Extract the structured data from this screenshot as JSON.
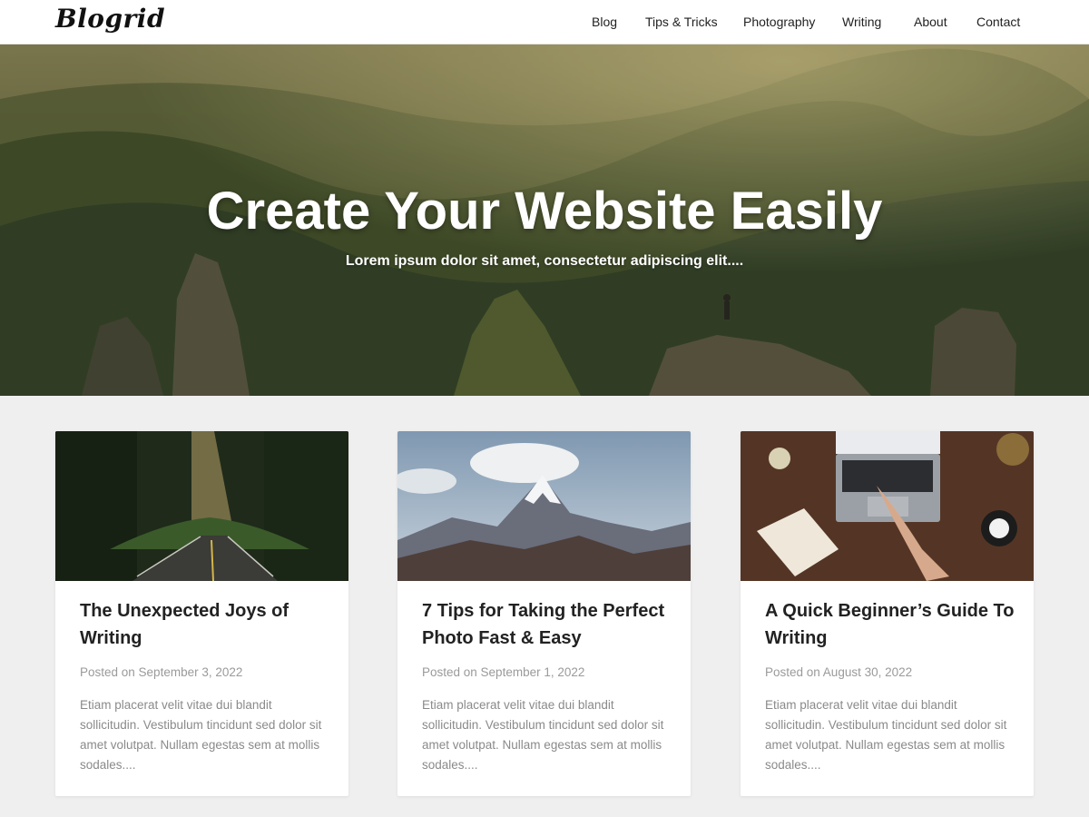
{
  "header": {
    "logo": "Blogrid",
    "nav": [
      "Blog",
      "Tips & Tricks",
      "Photography",
      "Writing",
      "About",
      "Contact"
    ]
  },
  "hero": {
    "title": "Create Your Website Easily",
    "subtitle": "Lorem ipsum dolor sit amet, consectetur adipiscing elit...."
  },
  "posts": [
    {
      "image": "forest-road-image",
      "title": "The Unexpected Joys of Writing",
      "date": "Posted on September 3, 2022",
      "excerpt": "Etiam placerat velit vitae dui blandit sollicitudin. Vestibulum tincidunt sed dolor sit amet volutpat. Nullam egestas sem at mollis sodales...."
    },
    {
      "image": "mountain-peak-image",
      "title": "7 Tips for Taking the Perfect Photo Fast & Easy",
      "date": "Posted on September 1, 2022",
      "excerpt": "Etiam placerat velit vitae dui blandit sollicitudin. Vestibulum tincidunt sed dolor sit amet volutpat. Nullam egestas sem at mollis sodales...."
    },
    {
      "image": "laptop-desk-image",
      "title": "A Quick Beginner’s Guide To Writing",
      "date": "Posted on August 30, 2022",
      "excerpt": "Etiam placerat velit vitae dui blandit sollicitudin. Vestibulum tincidunt sed dolor sit amet volutpat. Nullam egestas sem at mollis sodales...."
    }
  ]
}
